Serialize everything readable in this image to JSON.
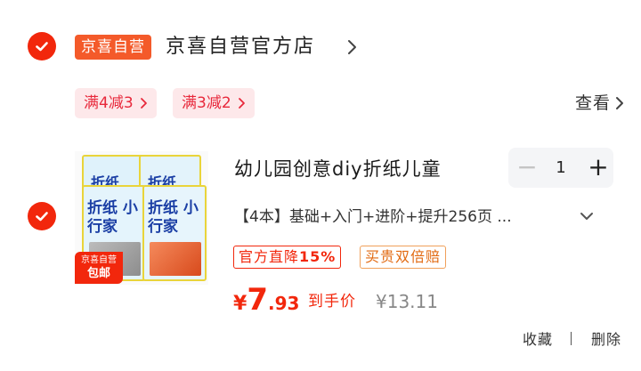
{
  "store": {
    "badge": "京喜自营",
    "name": "京喜自营官方店"
  },
  "coupons": [
    {
      "label": "满4减3"
    },
    {
      "label": "满3减2"
    }
  ],
  "view_more": "查看",
  "product": {
    "title": "幼儿园创意diy折纸儿童",
    "spec": "【4本】基础+入门+进阶+提升256页 ...",
    "quantity": "1",
    "tags": {
      "discount_prefix": "官方直降",
      "discount_value": "15%",
      "guarantee": "买贵双倍赔"
    },
    "price": {
      "currency": "¥",
      "integer": "7",
      "decimal": ".93",
      "label": "到手价",
      "original": "¥13.11"
    },
    "thumb": {
      "book1_title": "折纸",
      "book2_title": "折纸",
      "book3_title": "折纸 小行家",
      "book4_title": "折纸 小行家",
      "promo_line1": "京喜自营",
      "promo_line2": "包邮"
    }
  },
  "actions": {
    "favorite": "收藏",
    "separator": "|",
    "delete": "删除"
  },
  "colors": {
    "accent": "#f2270c",
    "badge_orange": "#f45a2a",
    "coupon_bg": "#fde8ea"
  },
  "icons": {
    "check": "check-circle-icon",
    "chevron": "chevron-right-icon",
    "expand": "chevron-down-icon"
  }
}
